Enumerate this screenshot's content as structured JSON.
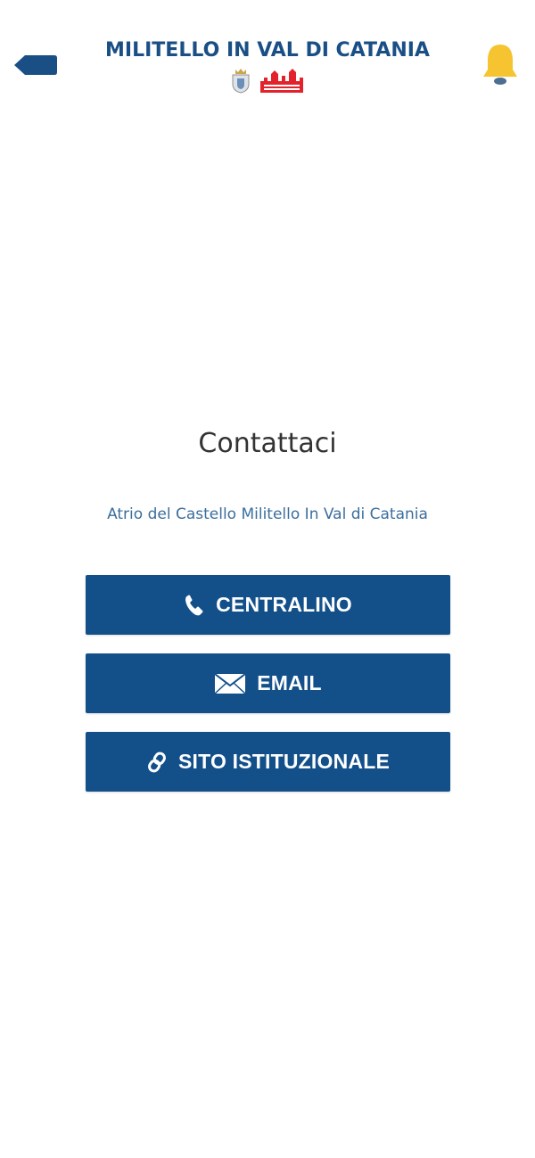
{
  "header": {
    "title": "MILITELLO IN VAL DI CATANIA",
    "back_icon": "back-arrow-icon",
    "notification_icon": "bell-icon",
    "logo_left": "municipal-coat-of-arms",
    "logo_right": "castle-logo",
    "colors": {
      "title": "#1a4f86",
      "back": "#1a4f86",
      "bell": "#f5c430",
      "logo_right": "#e3232c"
    }
  },
  "contact": {
    "title": "Contattaci",
    "address": "Atrio del Castello Militello In Val di Catania"
  },
  "buttons": [
    {
      "label": "CENTRALINO",
      "icon": "phone-icon"
    },
    {
      "label": "EMAIL",
      "icon": "envelope-icon"
    },
    {
      "label": "SITO ISTITUZIONALE",
      "icon": "link-icon"
    }
  ],
  "colors": {
    "button_background": "#13508a",
    "button_text": "#ffffff",
    "title_text": "#333333",
    "address_text": "#3b6e9e"
  }
}
